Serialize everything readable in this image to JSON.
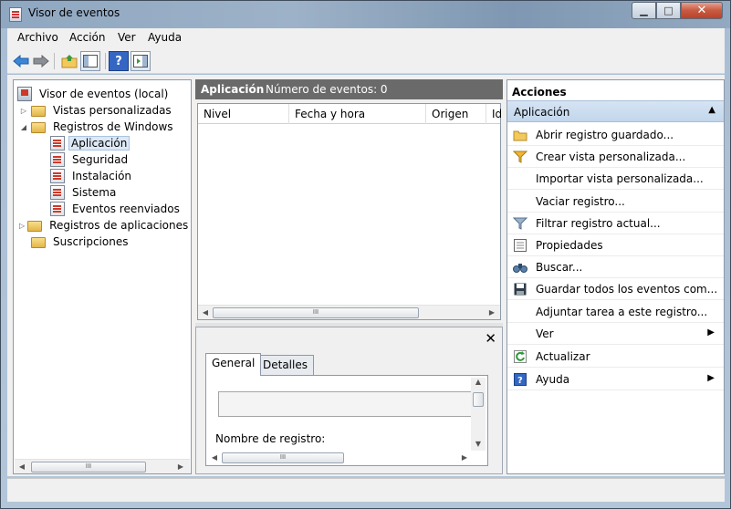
{
  "window": {
    "title": "Visor de eventos"
  },
  "menu": [
    "Archivo",
    "Acción",
    "Ver",
    "Ayuda"
  ],
  "tree": {
    "items": [
      {
        "label": "Visor de eventos (local)"
      },
      {
        "label": "Vistas personalizadas"
      },
      {
        "label": "Registros de Windows"
      },
      {
        "label": "Aplicación"
      },
      {
        "label": "Seguridad"
      },
      {
        "label": "Instalación"
      },
      {
        "label": "Sistema"
      },
      {
        "label": "Eventos reenviados"
      },
      {
        "label": "Registros de aplicaciones y s"
      },
      {
        "label": "Suscripciones"
      }
    ],
    "scroll_thumb": "III"
  },
  "center": {
    "title": "Aplicación",
    "count": "Número de eventos: 0",
    "columns": [
      "Nivel",
      "Fecha y hora",
      "Origen",
      "Id"
    ],
    "scroll_thumb": "III"
  },
  "detail": {
    "close": "✕",
    "tabs": [
      "General",
      "Detalles"
    ],
    "log_name_label": "Nombre de registro:",
    "scroll_thumb": "III"
  },
  "actions": {
    "header": "Acciones",
    "section": "Aplicación",
    "items": [
      {
        "label": "Abrir registro guardado...",
        "icon": "open-folder-icon"
      },
      {
        "label": "Crear vista personalizada...",
        "icon": "filter-icon"
      },
      {
        "label": "Importar vista personalizada...",
        "icon": ""
      },
      {
        "label": "Vaciar registro...",
        "icon": ""
      },
      {
        "label": "Filtrar registro actual...",
        "icon": "filter-icon"
      },
      {
        "label": "Propiedades",
        "icon": "properties-icon"
      },
      {
        "label": "Buscar...",
        "icon": "binoculars-icon"
      },
      {
        "label": "Guardar todos los eventos com...",
        "icon": "save-icon"
      },
      {
        "label": "Adjuntar tarea a este registro...",
        "icon": ""
      },
      {
        "label": "Ver",
        "icon": "",
        "submenu": true
      },
      {
        "label": "Actualizar",
        "icon": "refresh-icon"
      },
      {
        "label": "Ayuda",
        "icon": "help-icon",
        "submenu": true
      }
    ]
  },
  "colors": {
    "accent": "#c2d6ec",
    "header_bar": "#6a6a6a"
  }
}
